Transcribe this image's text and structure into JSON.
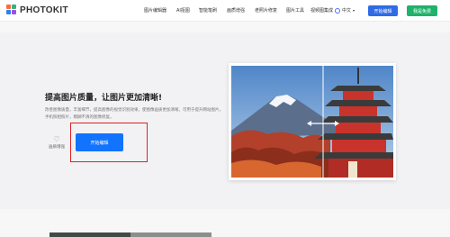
{
  "nav": {
    "logo_text": "PHOTOKIT",
    "menu": [
      "图片编辑器",
      "AI抠图",
      "智能笔刷",
      "画质增强",
      "老照片修复",
      "图片工具",
      "视频图集成"
    ],
    "lang": "中文",
    "edit_button": "开始编辑",
    "free_button": "我是免费"
  },
  "hero": {
    "title": "提高图片质量，让图片更加清晰!",
    "description": "改善图像质量，丰富细节，提高图像的视觉识别效果，使图像画质更加清晰。可用于提升网站图片，手机照相照片，模糊不清的图像修复。",
    "feature_label": "画质增强",
    "cta_button": "开始编辑"
  },
  "colors": {
    "accent": "#1273ff",
    "highlight_border": "#e02020",
    "green": "#1fb26b"
  }
}
